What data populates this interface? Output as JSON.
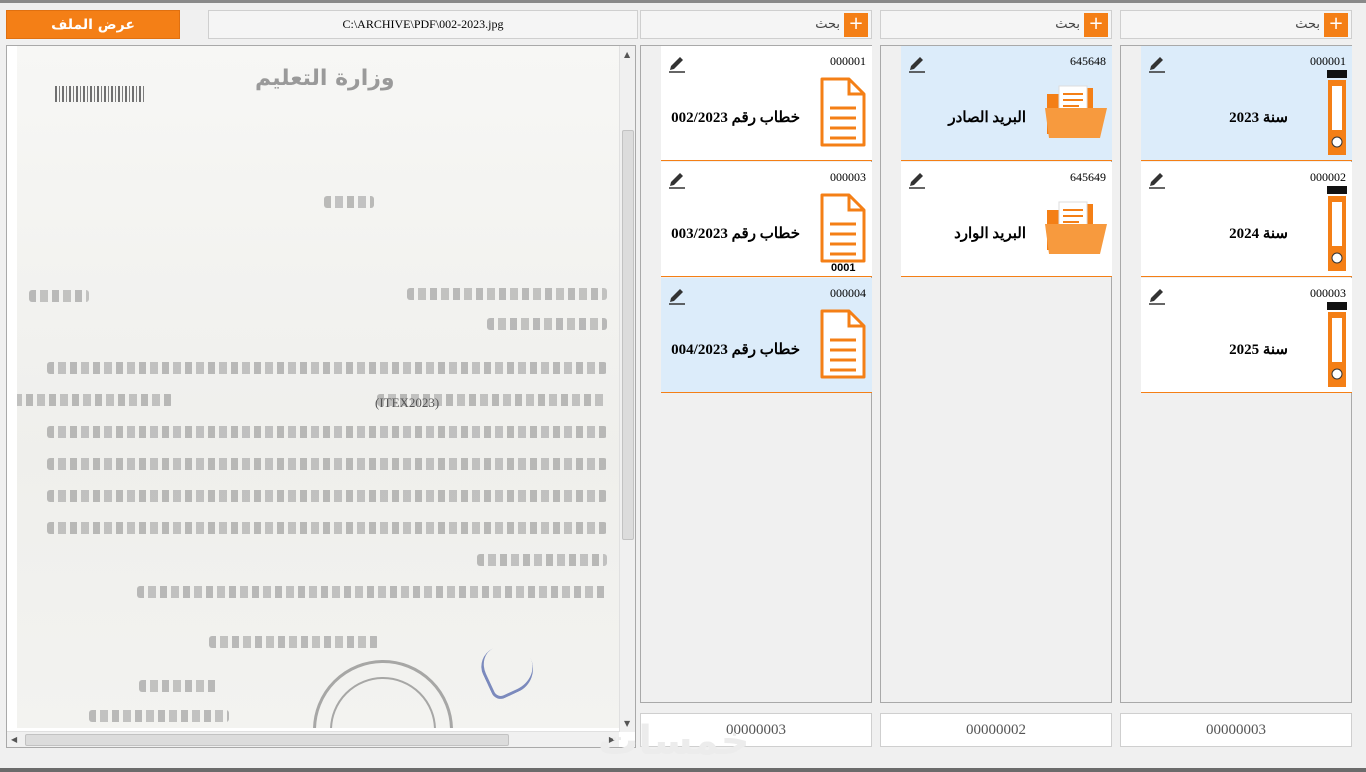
{
  "toolbar": {
    "view_file_label": "عرض الملف",
    "file_path": "C:\\ARCHIVE\\PDF\\002-2023.jpg"
  },
  "colors": {
    "accent": "#f47f16",
    "selected": "#dcecfa"
  },
  "document": {
    "ministry_text": "وزارة التعليم",
    "itex_text": "(ITEX2023)"
  },
  "panels": {
    "years": {
      "search_label": "بحث",
      "add_label": "+",
      "count": "00000003",
      "items": [
        {
          "code": "000001",
          "title": "سنة 2023",
          "icon": "binder-icon",
          "selected": true
        },
        {
          "code": "000002",
          "title": "سنة 2024",
          "icon": "binder-icon",
          "selected": false
        },
        {
          "code": "000003",
          "title": "سنة 2025",
          "icon": "binder-icon",
          "selected": false
        }
      ]
    },
    "mail": {
      "search_label": "بحث",
      "add_label": "+",
      "count": "00000002",
      "items": [
        {
          "code": "645648",
          "title": "البريد الصادر",
          "icon": "folder-icon",
          "selected": true
        },
        {
          "code": "645649",
          "title": "البريد الوارد",
          "icon": "folder-icon",
          "selected": false
        }
      ]
    },
    "letters": {
      "search_label": "بحث",
      "add_label": "+",
      "count": "00000003",
      "items": [
        {
          "code": "000001",
          "title": "خطاب رقم 002/2023",
          "icon": "document-icon",
          "selected": false
        },
        {
          "code": "000003",
          "title": "خطاب رقم 003/2023",
          "icon": "document-icon",
          "selected": false,
          "overlay": "0001"
        },
        {
          "code": "000004",
          "title": "خطاب رقم 004/2023",
          "icon": "document-icon",
          "selected": true
        }
      ]
    }
  },
  "watermark": "خمسات"
}
